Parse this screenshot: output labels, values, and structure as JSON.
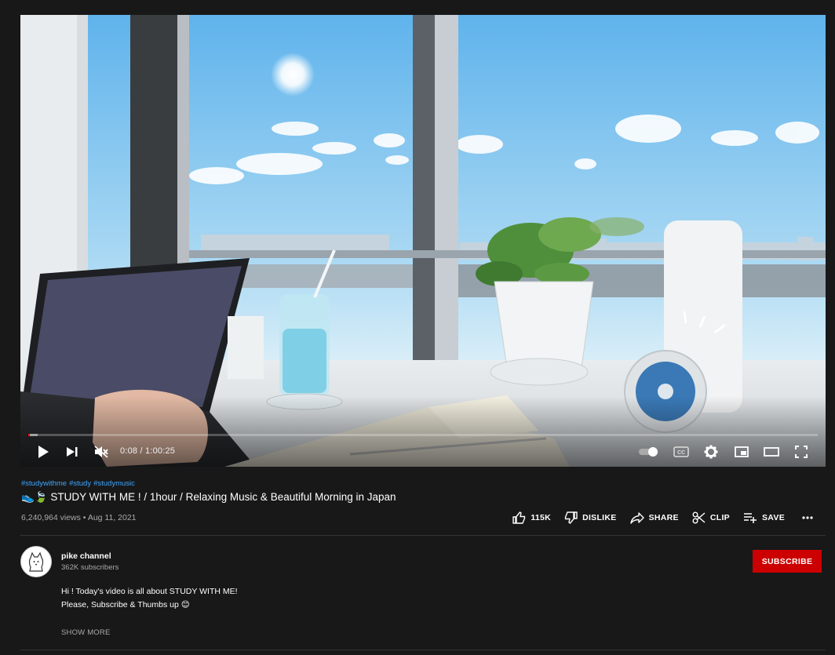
{
  "player": {
    "time_current": "0:08",
    "time_separator": " / ",
    "time_duration": "1:00:25",
    "played_fraction": 0.0022,
    "loaded_fraction": 0.012,
    "autoplay_on": true
  },
  "video": {
    "hashtags": [
      "#studywithme",
      "#study",
      "#studymusic"
    ],
    "title": "👟🍃 STUDY WITH ME ! / 1hour / Relaxing Music & Beautiful Morning in Japan",
    "views": "6,240,964 views",
    "dot": " • ",
    "date": "Aug 11, 2021"
  },
  "actions": {
    "like_count": "115K",
    "dislike_label": "DISLIKE",
    "share_label": "SHARE",
    "clip_label": "CLIP",
    "save_label": "SAVE"
  },
  "channel": {
    "name": "pike channel",
    "subscribers": "362K subscribers",
    "subscribe_label": "SUBSCRIBE"
  },
  "description": {
    "line1": "Hi ! Today's video is all about STUDY WITH ME!",
    "line2": "Please, Subscribe & Thumbs up 😊",
    "show_more": "SHOW MORE"
  },
  "colors": {
    "background": "#181818",
    "accent_red": "#cc0000",
    "link_blue": "#3ea6ff",
    "sky": "#7fc3ec"
  },
  "icons": [
    "play-icon",
    "next-icon",
    "mute-icon",
    "autoplay-toggle-icon",
    "cc-icon",
    "settings-icon",
    "miniplayer-icon",
    "theater-icon",
    "fullscreen-icon",
    "thumbs-up-icon",
    "thumbs-down-icon",
    "share-icon",
    "scissors-icon",
    "playlist-add-icon",
    "more-icon"
  ]
}
